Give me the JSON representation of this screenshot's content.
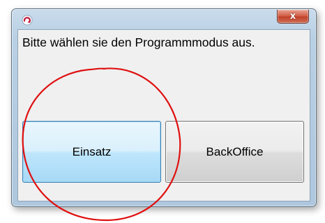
{
  "window": {
    "title": "",
    "icon": "app-swirl-icon",
    "close_symbol": "x"
  },
  "dialog": {
    "message": "Bitte wählen sie den Programmmodus aus."
  },
  "buttons": {
    "einsatz_label": "Einsatz",
    "backoffice_label": "BackOffice"
  },
  "colors": {
    "annotation_circle": "#e01010",
    "close_button": "#c7432c",
    "focused_button_border": "#3c7fb1"
  },
  "annotation": {
    "shape": "circle",
    "highlights": "Einsatz button"
  }
}
